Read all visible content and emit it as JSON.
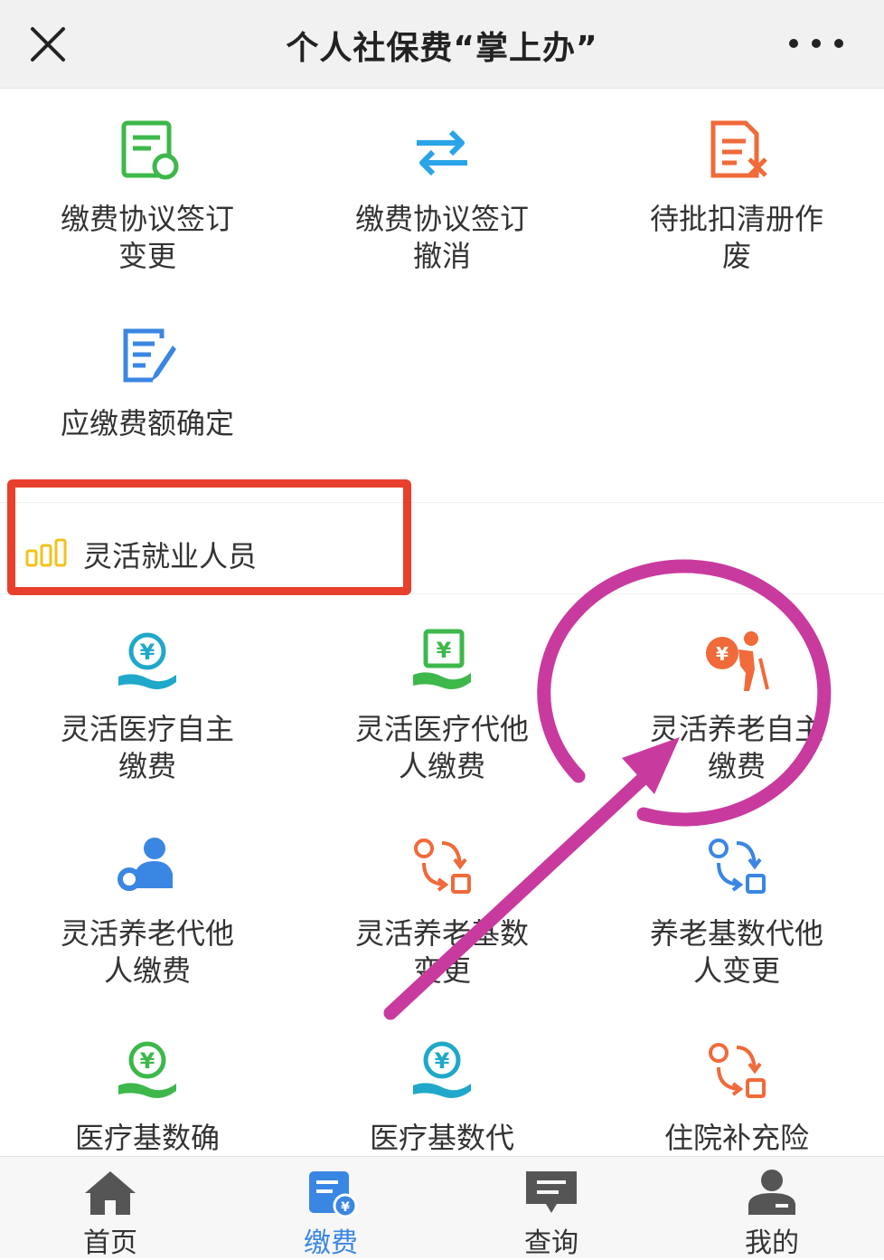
{
  "header": {
    "title": "个人社保费“掌上办”",
    "close_icon": "close-icon",
    "more_icon": "more-icon"
  },
  "services_top": [
    {
      "label": "缴费协议签订变更",
      "icon": "document-refresh-icon",
      "color": "#3db84a"
    },
    {
      "label": "缴费协议签订撤消",
      "icon": "exchange-arrows-icon",
      "color": "#2aa4e8"
    },
    {
      "label": "待批扣清册作废",
      "icon": "document-cancel-icon",
      "color": "#f06a3a"
    },
    {
      "label": "应缴费额确定",
      "icon": "document-edit-icon",
      "color": "#3a86e3"
    }
  ],
  "section": {
    "title": "灵活就业人员",
    "icon": "bar-chart-icon",
    "icon_color": "#f2c21a"
  },
  "services_flex": [
    {
      "label": "灵活医疗自主缴费",
      "icon": "yuan-hand-icon",
      "color": "#1fa8c9"
    },
    {
      "label": "灵活医疗代他人缴费",
      "icon": "yuan-tablet-icon",
      "color": "#3db84a"
    },
    {
      "label": "灵活养老自主缴费",
      "icon": "elder-person-icon",
      "color": "#f06a3a"
    },
    {
      "label": "灵活养老代他人缴费",
      "icon": "person-gear-icon",
      "color": "#3a86e3"
    },
    {
      "label": "灵活养老基数变更",
      "icon": "swap-circle-square-icon",
      "color": "#f06a3a"
    },
    {
      "label": "养老基数代他人变更",
      "icon": "swap-circle-square-icon",
      "color": "#3a86e3"
    },
    {
      "label": "医疗基数确",
      "icon": "yuan-hand-icon",
      "color": "#3db84a"
    },
    {
      "label": "医疗基数代",
      "icon": "yuan-hand-icon",
      "color": "#1fa8c9"
    },
    {
      "label": "住院补充险",
      "icon": "swap-circle-square-icon",
      "color": "#f06a3a"
    }
  ],
  "tabbar": {
    "active_color": "#3a86e3",
    "items": [
      {
        "label": "首页",
        "icon": "home-icon"
      },
      {
        "label": "缴费",
        "icon": "payment-icon"
      },
      {
        "label": "查询",
        "icon": "message-icon"
      },
      {
        "label": "我的",
        "icon": "user-icon"
      }
    ]
  },
  "annotations": {
    "box_color": "#e8402c",
    "circle_color": "#c93a9e",
    "arrow_color": "#c93a9e"
  }
}
